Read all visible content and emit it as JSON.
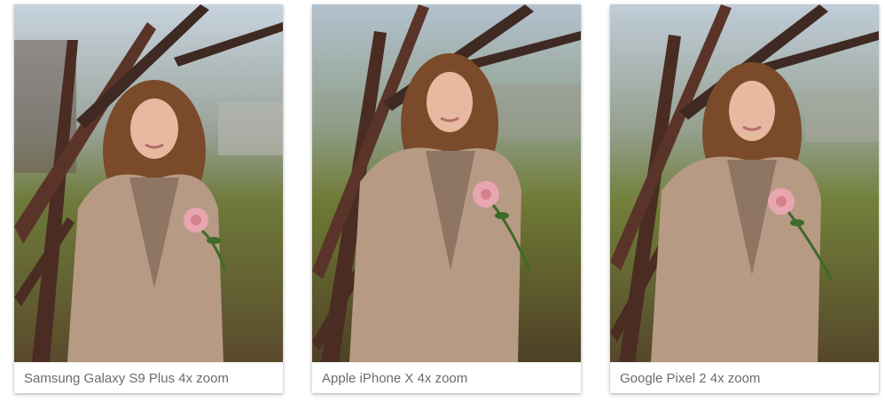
{
  "gallery": {
    "items": [
      {
        "caption": "Samsung Galaxy S9 Plus 4x zoom"
      },
      {
        "caption": "Apple iPhone X 4x zoom"
      },
      {
        "caption": "Google Pixel 2 4x zoom"
      }
    ]
  },
  "colors": {
    "sky": "#b9c9d8",
    "grass": "#7a7a3a",
    "ground": "#5a4a2c",
    "coat": "#b79a84",
    "coat_shadow": "#8f7563",
    "hair": "#7a4a2a",
    "skin": "#e6b9a0",
    "flower": "#e8a6b0",
    "leaf": "#3e6a2a",
    "trunk": "#4a2c22",
    "caption_text": "#6b6b6b"
  }
}
